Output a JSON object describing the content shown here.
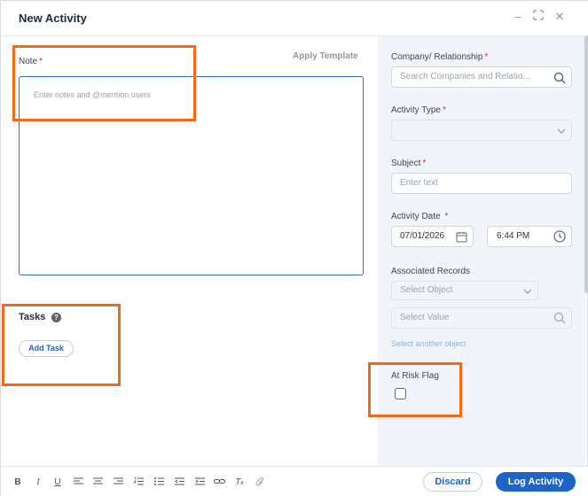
{
  "dialog": {
    "title": "New Activity"
  },
  "note": {
    "label": "Note",
    "required_mark": "*",
    "apply_template": "Apply Template",
    "placeholder": "Enter notes and @mention users"
  },
  "tasks": {
    "title": "Tasks",
    "help": "?",
    "add_task": "Add Task"
  },
  "company": {
    "label": "Company/ Relationship",
    "required_mark": "*",
    "placeholder": "Search Companies and Relatio..."
  },
  "activity_type": {
    "label": "Activity Type",
    "required_mark": "*",
    "value": ""
  },
  "subject": {
    "label": "Subject",
    "required_mark": "*",
    "placeholder": "Enter text"
  },
  "activity_date": {
    "label": "Activity Date",
    "required_mark": "*",
    "date": "07/01/2026",
    "time": "6:44 PM"
  },
  "associated": {
    "label": "Associated Records",
    "select_object": "Select Object",
    "select_value": "Select Value",
    "another": "Select another object"
  },
  "risk": {
    "label": "At Risk Flag",
    "checked": false
  },
  "toolbar": {
    "bold": "B",
    "italic": "I",
    "underline": "U"
  },
  "footer": {
    "discard": "Discard",
    "log": "Log Activity"
  },
  "colors": {
    "primary": "#1e64c8",
    "highlight": "#ee6b1c",
    "required": "#d9262c"
  },
  "icons": [
    "minimize-icon",
    "maximize-icon",
    "close-icon",
    "search-icon",
    "chevron-down-icon",
    "calendar-icon",
    "clock-icon",
    "help-icon"
  ]
}
